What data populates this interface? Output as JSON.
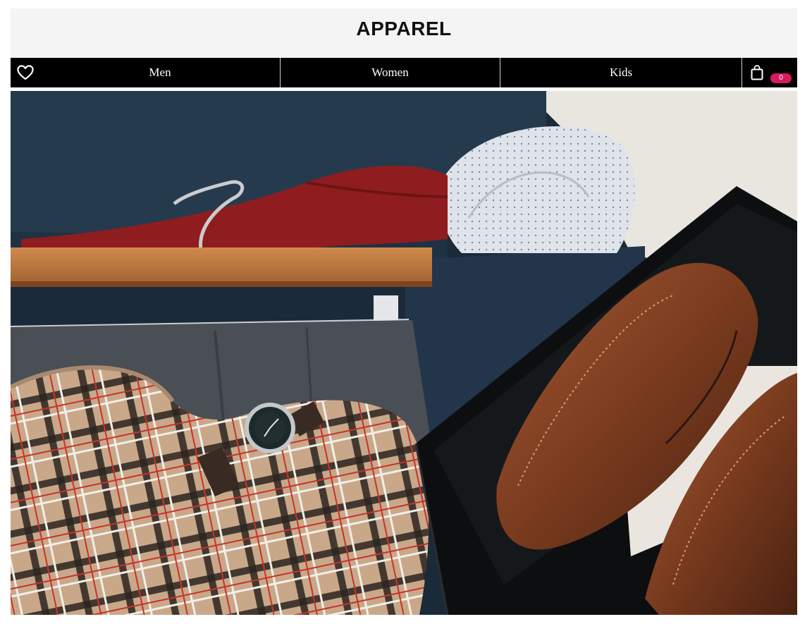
{
  "header": {
    "brand": "APPAREL"
  },
  "nav": {
    "wishlist_icon": "heart-icon",
    "items": [
      {
        "label": "Men"
      },
      {
        "label": "Women"
      },
      {
        "label": "Kids"
      }
    ],
    "cart": {
      "icon": "shopping-bag-icon",
      "count": "0"
    }
  },
  "hero": {
    "image": "flat lay of menswear: suit jacket, red tie, dotted shirt on hanger, grey trousers, plaid scarf, wristwatch, brown brogue shoes in black box"
  },
  "colors": {
    "header_bg": "#f4f4f4",
    "nav_bg": "#000000",
    "nav_text": "#ffffff",
    "badge": "#d81b60"
  }
}
